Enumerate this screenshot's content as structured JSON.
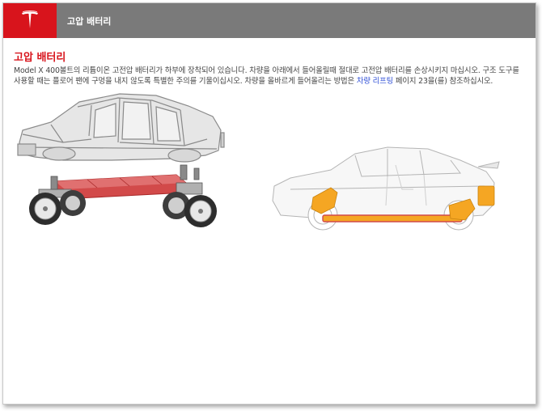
{
  "header": {
    "title": "고압 배터리",
    "logo_icon": "tesla-t-logo-icon",
    "brand_color": "#d8141c",
    "bar_color": "#7a7a7a"
  },
  "section": {
    "title": "고압 배터리",
    "text_part1": "Model X 400볼트의 리튬이온 고전압 배터리가 하부에 장착되어 있습니다. 차량을 아래에서 들어올릴때 절대로 고전압 배터리를 손상시키지 마십시오. 구조 도구를 사용할 때는 플로어 팬에 구멍을 내지 않도록 특별한 주의를 기울이십시오. 차량을 올바르게 들어올리는 방법은 ",
    "link_text": "차량 리프팅",
    "text_part2": " 페이지 23을(를) 참조하십시오."
  },
  "illustrations": {
    "left_icon": "exploded-body-battery-chassis-illustration",
    "right_icon": "car-side-battery-location-illustration",
    "battery_color_red": "#d24a4a",
    "battery_color_orange": "#f5a623"
  }
}
